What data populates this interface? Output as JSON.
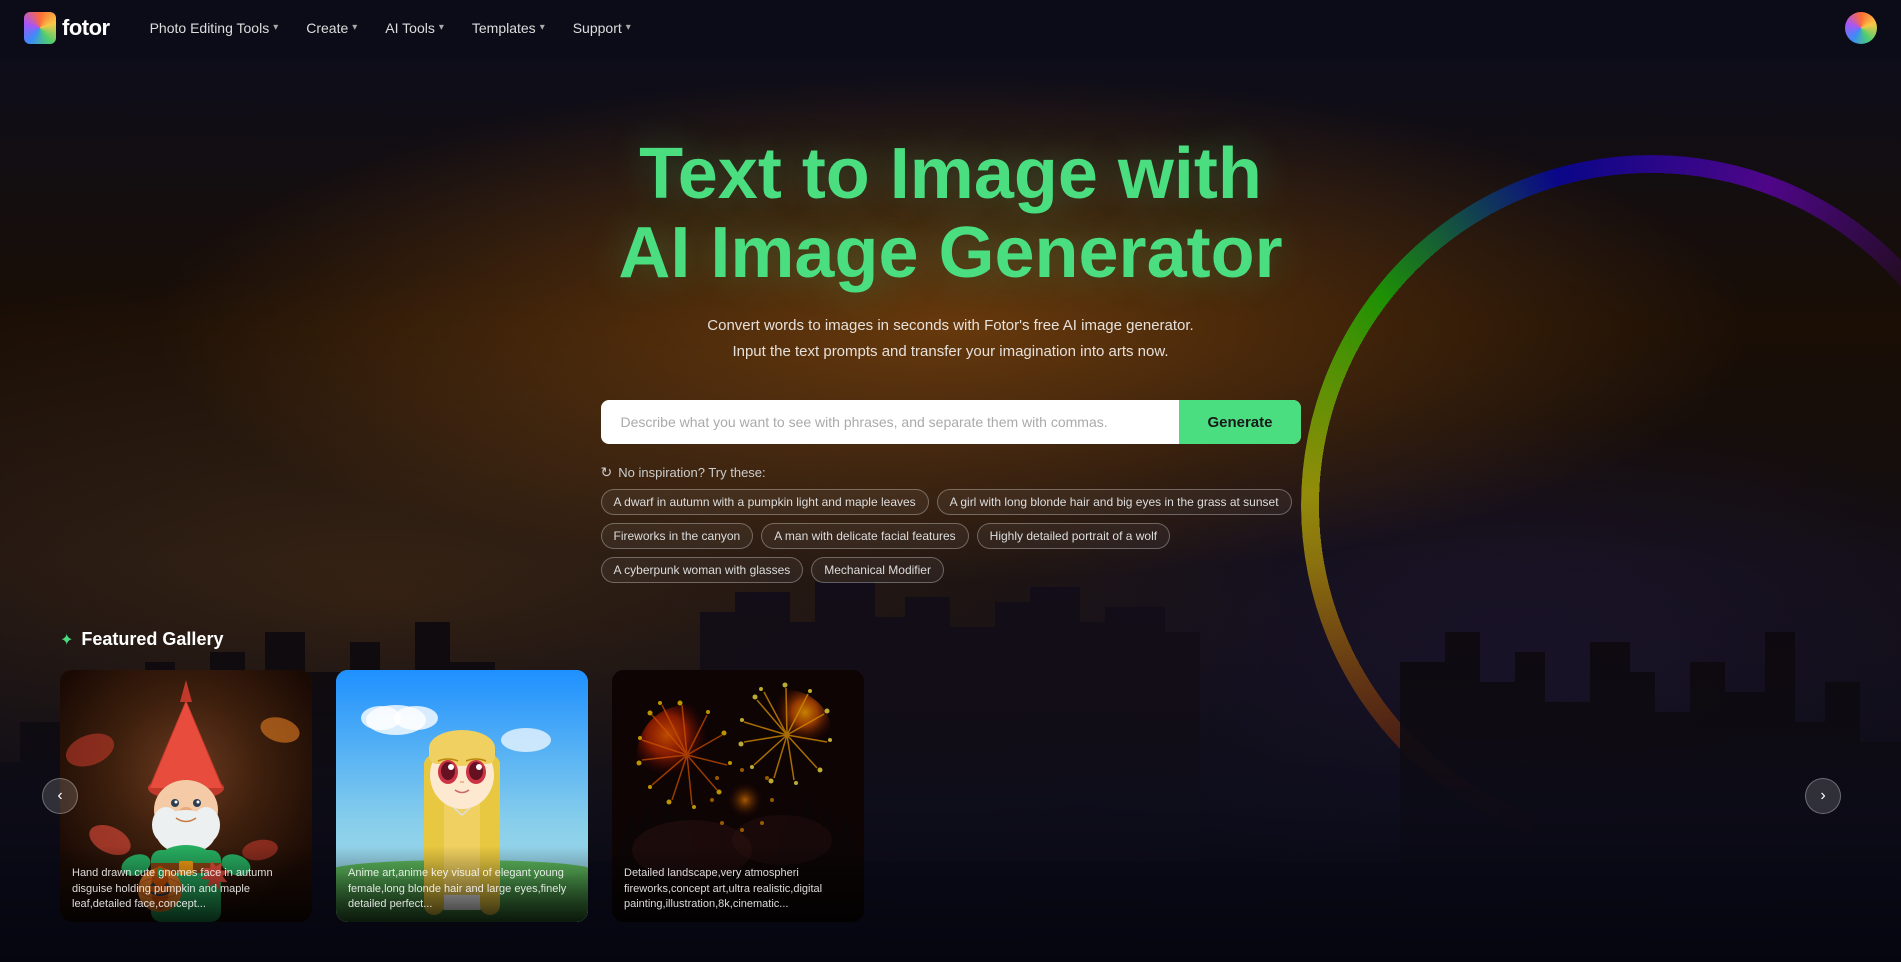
{
  "nav": {
    "logo_text": "fotor",
    "items": [
      {
        "id": "photo-editing-tools",
        "label": "Photo Editing Tools",
        "has_chevron": true
      },
      {
        "id": "create",
        "label": "Create",
        "has_chevron": true
      },
      {
        "id": "ai-tools",
        "label": "AI Tools",
        "has_chevron": true
      },
      {
        "id": "templates",
        "label": "Templates",
        "has_chevron": true
      },
      {
        "id": "support",
        "label": "Support",
        "has_chevron": true
      }
    ]
  },
  "hero": {
    "title_line1": "Text to Image with",
    "title_line2": "AI Image Generator",
    "subtitle": "Convert words to images in seconds with Fotor's free AI image generator. Input the text prompts and transfer your imagination into arts now.",
    "search_placeholder": "Describe what you want to see with phrases, and separate them with commas.",
    "generate_label": "Generate",
    "inspiration_label": "No inspiration? Try these:",
    "prompt_tags_row1": [
      "A dwarf in autumn with a pumpkin light and maple leaves",
      "A girl with long blonde hair and big eyes in the grass at sunset"
    ],
    "prompt_tags_row2": [
      "Fireworks in the canyon",
      "A man with delicate facial features",
      "Highly detailed portrait of a wolf",
      "A cyberpunk woman with glasses",
      "Mechanical Modifier"
    ]
  },
  "gallery": {
    "section_label": "Featured Gallery",
    "cards": [
      {
        "id": "gnome",
        "caption": "Hand drawn cute gnomes face in autumn disguise holding pumpkin and maple leaf,detailed face,concept..."
      },
      {
        "id": "anime",
        "caption": "Anime art,anime key visual of elegant young female,long blonde hair and large eyes,finely detailed perfect..."
      },
      {
        "id": "fireworks",
        "caption": "Detailed landscape,very atmospheri fireworks,concept art,ultra realistic,digital painting,illustration,8k,cinematic..."
      }
    ],
    "prev_label": "‹",
    "next_label": "›"
  }
}
